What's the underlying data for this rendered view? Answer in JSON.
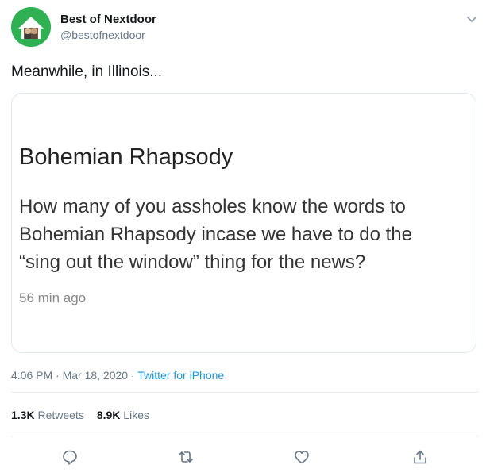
{
  "user": {
    "display_name": "Best of Nextdoor",
    "handle": "@bestofnextdoor"
  },
  "tweet": {
    "text": "Meanwhile, in Illinois..."
  },
  "card": {
    "title": "Bohemian Rhapsody",
    "body_lines": [
      "How many of you assholes know the words to",
      "Bohemian Rhapsody incase we have to do the",
      "“sing out the window” thing for the news?"
    ],
    "time_ago": "56 min ago"
  },
  "meta": {
    "timestamp": "4:06 PM · Mar 18, 2020 · ",
    "source": "Twitter for iPhone"
  },
  "stats": {
    "retweets_count": "1.3K",
    "retweets_label": "Retweets",
    "likes_count": "8.9K",
    "likes_label": "Likes"
  },
  "icons": {
    "avatar": "house-logo-avatar",
    "menu": "chevron-down-icon",
    "reply": "reply-icon",
    "retweet": "retweet-icon",
    "like": "heart-icon",
    "share": "share-icon"
  },
  "colors": {
    "link": "#1b95e0",
    "avatar_bg": "#2fb052",
    "muted": "#657786"
  }
}
